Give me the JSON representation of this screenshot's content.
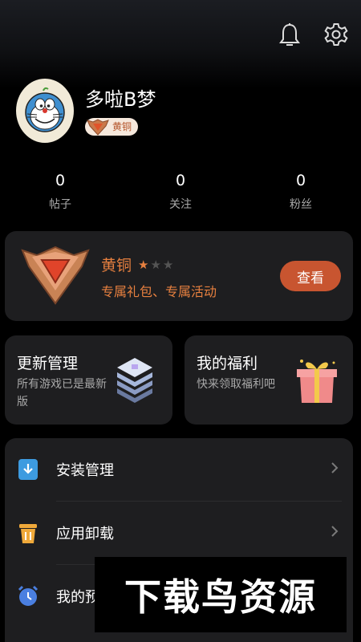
{
  "header": {
    "icons": [
      "bell-icon",
      "gear-icon"
    ]
  },
  "profile": {
    "username": "多啦B梦",
    "rank_badge": "黄铜",
    "avatar_icon": "doraemon-avatar"
  },
  "stats": [
    {
      "value": "0",
      "label": "帖子"
    },
    {
      "value": "0",
      "label": "关注"
    },
    {
      "value": "0",
      "label": "粉丝"
    }
  ],
  "vip": {
    "title": "黄铜",
    "stars_total": 3,
    "stars_filled": 1,
    "subtitle": "专属礼包、专属活动",
    "button": "查看",
    "accent": "#e7803f",
    "button_color": "#c85530"
  },
  "features": [
    {
      "title": "更新管理",
      "desc": "所有游戏已是最新版",
      "icon": "layers-stack-icon"
    },
    {
      "title": "我的福利",
      "desc": "快来领取福利吧",
      "icon": "gift-box-icon"
    }
  ],
  "menu": [
    {
      "label": "安装管理",
      "icon": "install-icon"
    },
    {
      "label": "应用卸载",
      "icon": "trash-icon"
    },
    {
      "label": "我的预约",
      "icon": "alarm-clock-icon"
    }
  ],
  "watermark": "下载鸟资源"
}
